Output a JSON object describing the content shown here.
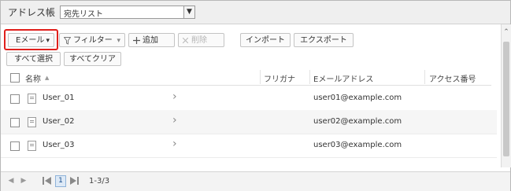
{
  "header": {
    "title": "アドレス帳",
    "list_select": "宛先リスト",
    "dropdown_arrow": "▼"
  },
  "toolbar": {
    "email": "Eメール",
    "email_arrow": "▾",
    "filter": "フィルター",
    "filter_arrow": "▾",
    "add": "追加",
    "delete": "削除",
    "import": "インポート",
    "export": "エクスポート",
    "select_all": "すべて選択",
    "clear_all": "すべてクリア"
  },
  "table": {
    "columns": [
      "名称",
      "フリガナ",
      "Eメールアドレス",
      "アクセス番号"
    ],
    "sort_indicator": "▲",
    "rows": [
      {
        "name": "User_01",
        "furigana": "",
        "email": "user01@example.com",
        "access": ""
      },
      {
        "name": "User_02",
        "furigana": "",
        "email": "user02@example.com",
        "access": ""
      },
      {
        "name": "User_03",
        "furigana": "",
        "email": "user03@example.com",
        "access": ""
      }
    ],
    "row_chevron": "›"
  },
  "pagination": {
    "current_page": "1",
    "range": "1-3/3"
  },
  "icons": [
    "filter-icon",
    "plus-icon",
    "close-icon",
    "document-icon",
    "chevron-right-icon",
    "first-page-icon",
    "prev-page-icon",
    "next-page-icon",
    "last-page-icon"
  ],
  "colors": {
    "highlight": "#e0201c",
    "page_active": "#dde9f6"
  }
}
